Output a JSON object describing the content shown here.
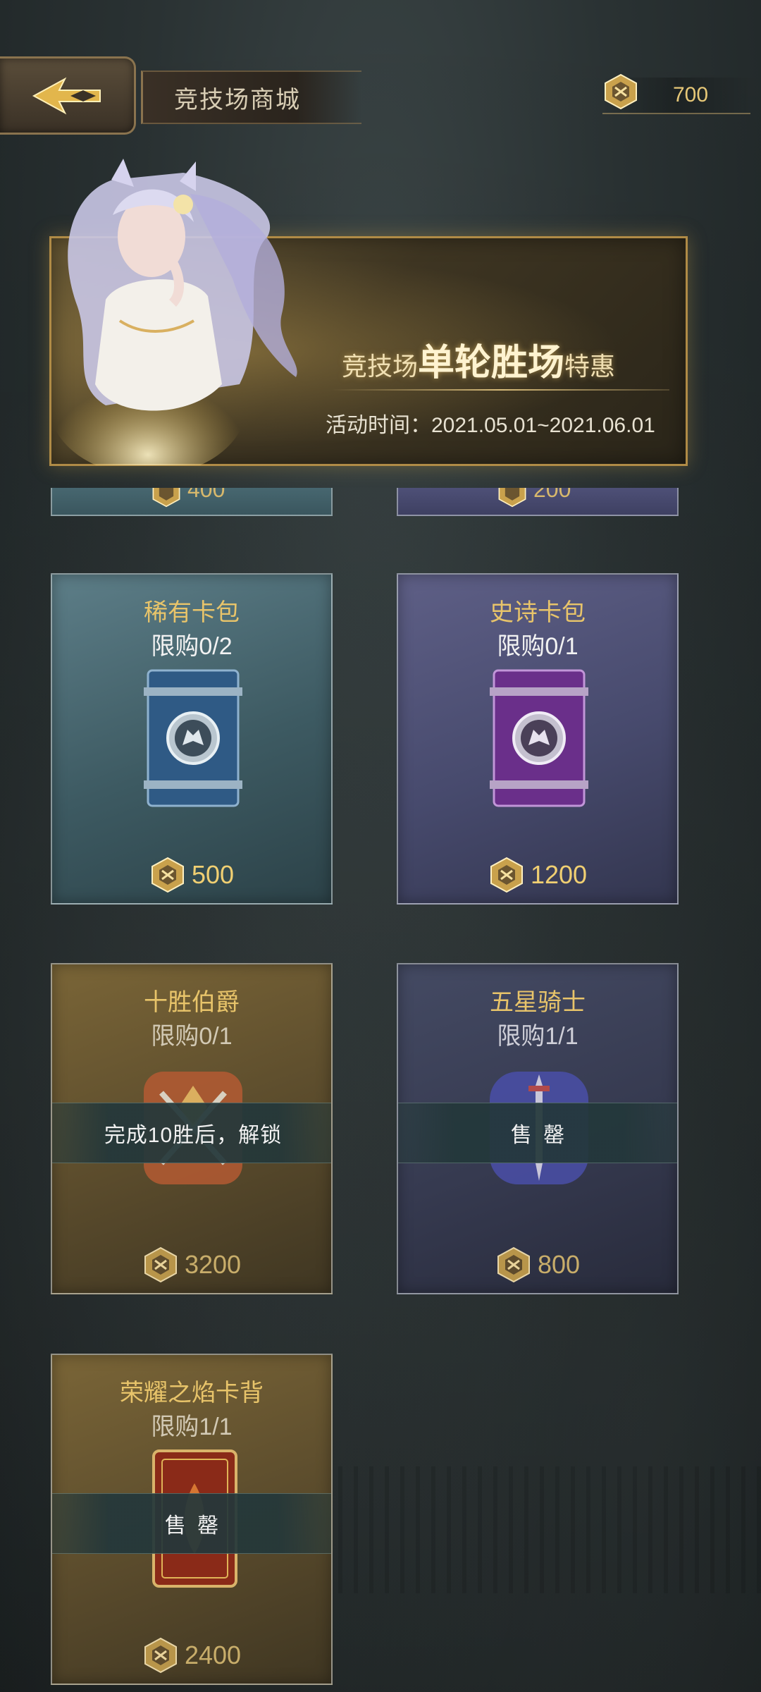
{
  "header": {
    "title": "竞技场商城",
    "currency_amount": "700",
    "back_icon": "back-arrow-icon",
    "currency_icon": "arena-coin-icon"
  },
  "banner": {
    "title_prefix": "竞技场",
    "title_emphasis": "单轮胜场",
    "title_suffix": "特惠",
    "date": "活动时间：2021.05.01~2021.06.01"
  },
  "partial_cards": [
    {
      "price": "400"
    },
    {
      "price": "200"
    }
  ],
  "cards": [
    {
      "name": "稀有卡包",
      "limit": "限购0/2",
      "price": "500",
      "theme": "blue",
      "art": "rare-card-pack-icon",
      "overlay": ""
    },
    {
      "name": "史诗卡包",
      "limit": "限购0/1",
      "price": "1200",
      "theme": "purple",
      "art": "epic-card-pack-icon",
      "overlay": ""
    },
    {
      "name": "十胜伯爵",
      "limit": "限购0/1",
      "price": "3200",
      "theme": "gold",
      "art": "count-emblem-icon",
      "overlay": "完成10胜后，解锁"
    },
    {
      "name": "五星骑士",
      "limit": "限购1/1",
      "price": "800",
      "theme": "navy",
      "art": "knight-emblem-icon",
      "overlay": "售 罄"
    },
    {
      "name": "荣耀之焰卡背",
      "limit": "限购1/1",
      "price": "2400",
      "theme": "gold",
      "art": "card-back-icon",
      "overlay": "售 罄"
    }
  ],
  "colors": {
    "accent_gold": "#e8c46a",
    "price_gold": "#f0cf72",
    "banner_border": "#b08b46"
  }
}
